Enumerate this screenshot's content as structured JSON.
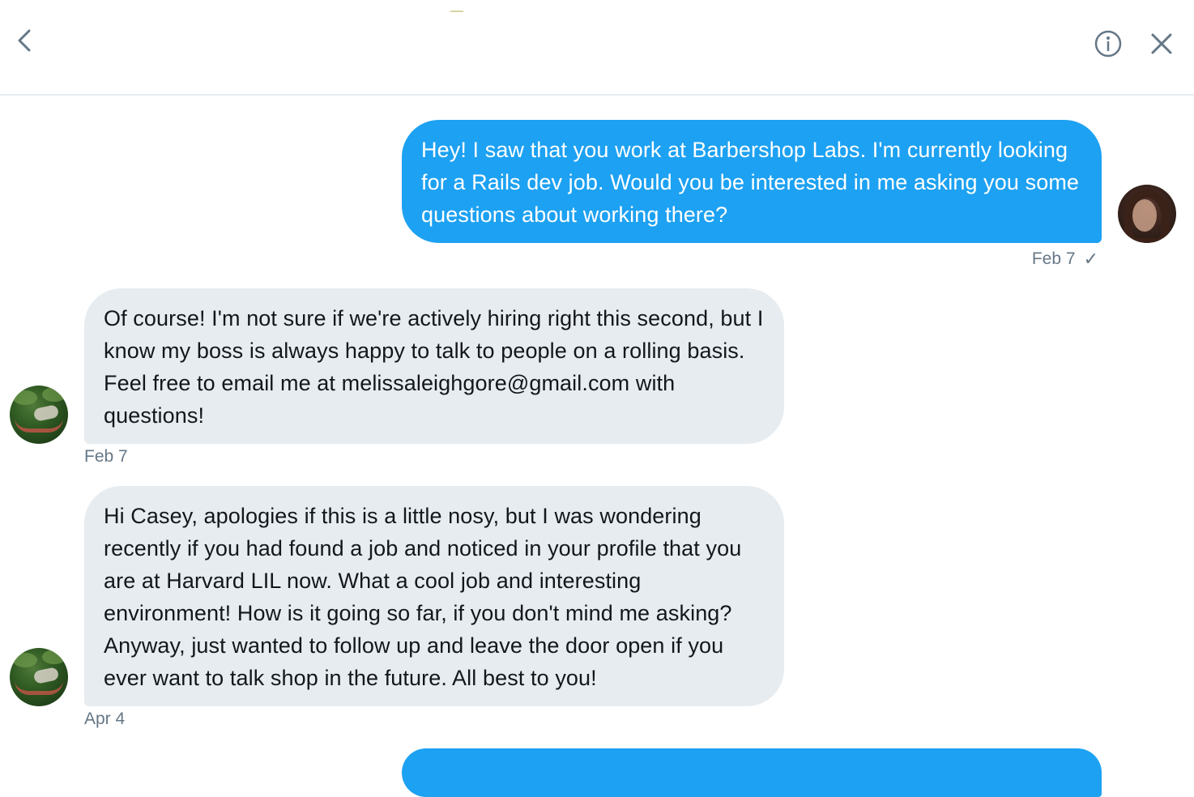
{
  "header": {
    "back_icon": "chevron-left-icon",
    "info_icon": "info-icon",
    "close_icon": "close-icon"
  },
  "messages": [
    {
      "direction": "sent",
      "text": "Hey! I saw that you work at Barbershop Labs. I'm currently looking for a Rails dev job. Would you be interested in me asking you some questions about working there?",
      "date": "Feb 7",
      "status_icon": "checkmark-icon",
      "status_glyph": "✓"
    },
    {
      "direction": "received",
      "text": "Of course! I'm not sure if we're actively hiring right this second, but I know my boss is always happy to talk to people on a rolling basis. Feel free to email me at melissaleighgore@gmail.com with questions!",
      "date": "Feb 7"
    },
    {
      "direction": "received",
      "text": "Hi Casey, apologies if this is a little nosy, but I was wondering recently if you had found a job and noticed in your profile that you are at Harvard LIL now. What a cool job and interesting environment! How is it going so far, if you don't mind me asking? Anyway, just wanted to follow up and leave the door open if you ever want to talk shop in the future. All best to you!",
      "date": "Apr 4"
    }
  ],
  "colors": {
    "sent_bubble": "#1da1f2",
    "received_bubble": "#e6ecf0",
    "meta_text": "#657786",
    "icon": "#657786"
  }
}
